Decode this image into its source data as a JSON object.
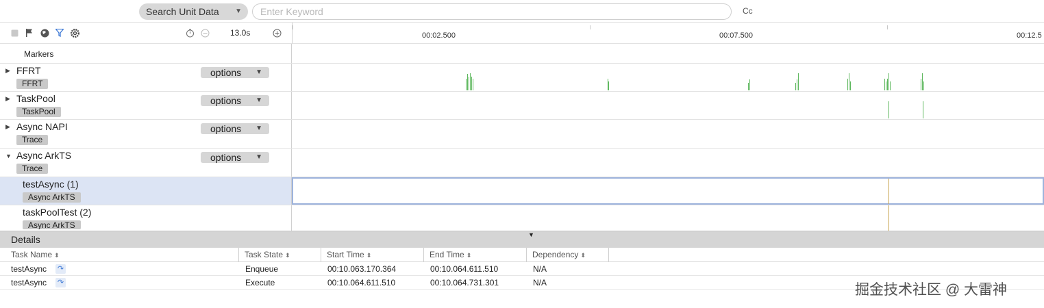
{
  "search": {
    "type_label": "Search Unit Data",
    "placeholder": "Enter Keyword",
    "case_toggle": "Cc"
  },
  "toolbar": {
    "icons": [
      "stop-icon",
      "flag-icon",
      "globe-icon",
      "filter-icon",
      "settings-icon",
      "timer-icon",
      "zoom-out-icon",
      "zoom-in-icon"
    ],
    "zoom_level": "13.0s"
  },
  "ruler": {
    "labels": [
      "00:02.500",
      "00:07.500",
      "00:12.5"
    ]
  },
  "tracks": {
    "markers_label": "Markers",
    "ffrt": {
      "title": "FFRT",
      "badge": "FFRT",
      "options": "options"
    },
    "taskpool": {
      "title": "TaskPool",
      "badge": "TaskPool",
      "options": "options"
    },
    "async_napi": {
      "title": "Async NAPI",
      "badge": "Trace",
      "options": "options"
    },
    "async_arkts": {
      "title": "Async ArkTS",
      "badge": "Trace",
      "options": "options"
    },
    "test_async": {
      "title": "testAsync (1)",
      "badge": "Async ArkTS"
    },
    "task_pool_test": {
      "title": "taskPoolTest (2)",
      "badge": "Async ArkTS"
    }
  },
  "details": {
    "title": "Details",
    "columns": [
      "Task Name",
      "Task State",
      "Start Time",
      "End Time",
      "Dependency"
    ],
    "rows": [
      {
        "task_name": "testAsync",
        "task_state": "Enqueue",
        "start_time": "00:10.063.170.364",
        "end_time": "00:10.064.611.510",
        "dependency": "N/A"
      },
      {
        "task_name": "testAsync",
        "task_state": "Execute",
        "start_time": "00:10.064.611.510",
        "end_time": "00:10.064.731.301",
        "dependency": "N/A"
      }
    ]
  },
  "watermark": "掘金技术社区 @ 大雷神",
  "colors": {
    "activity_spike": "#5fb85f",
    "selection_line": "#c9a552",
    "selected_row": "#dce4f4",
    "link_accent": "#3f7ad6"
  }
}
